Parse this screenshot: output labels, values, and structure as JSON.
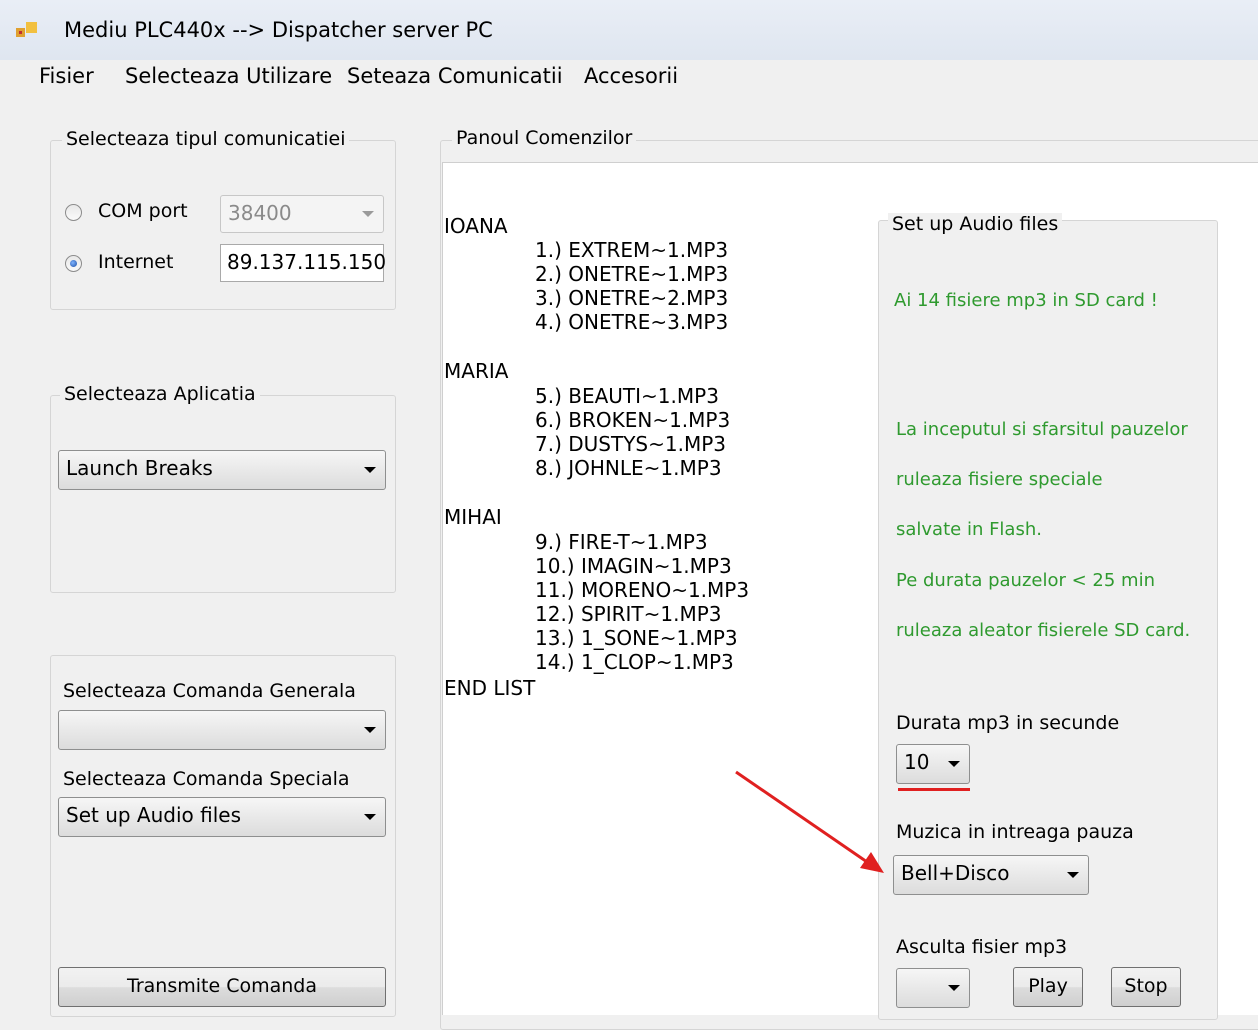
{
  "window": {
    "title": "Mediu PLC440x --> Dispatcher server PC"
  },
  "menu": [
    "Fisier",
    "Selecteaza Utilizare",
    "Seteaza Comunicatii",
    "Accesorii"
  ],
  "comm": {
    "group_label": "Selecteaza tipul comunicatiei",
    "com_label": "COM port",
    "com_value": "38400",
    "internet_label": "Internet",
    "internet_value": "89.137.115.150",
    "selected": "Internet"
  },
  "app": {
    "group_label": "Selecteaza Aplicatia",
    "value": "Launch Breaks"
  },
  "commands": {
    "general_label": "Selecteaza Comanda Generala",
    "general_value": "",
    "special_label": "Selecteaza Comanda Speciala",
    "special_value": "Set up Audio files",
    "transmit_label": "Transmite Comanda"
  },
  "panel": {
    "label": "Panoul Comenzilor",
    "users": [
      {
        "name": "IOANA",
        "files": [
          "1.)  EXTREM~1.MP3",
          "2.)  ONETRE~1.MP3",
          "3.)  ONETRE~2.MP3",
          "4.)  ONETRE~3.MP3"
        ]
      },
      {
        "name": "MARIA",
        "files": [
          "5.)  BEAUTI~1.MP3",
          "6.)  BROKEN~1.MP3",
          "7.)  DUSTYS~1.MP3",
          "8.)  JOHNLE~1.MP3"
        ]
      },
      {
        "name": "MIHAI",
        "files": [
          "9.)  FIRE-T~1.MP3",
          "10.)  IMAGIN~1.MP3",
          "11.)  MORENO~1.MP3",
          "12.)  SPIRIT~1.MP3",
          "13.)  1_SONE~1.MP3",
          "14.)  1_CLOP~1.MP3"
        ]
      }
    ],
    "end": "END LIST"
  },
  "audio": {
    "group_label": "Set up Audio files",
    "sd_count_msg": "Ai 14 fisiere mp3 in SD card !",
    "info_lines": [
      "La inceputul si sfarsitul pauzelor",
      "ruleaza fisiere speciale",
      "salvate in Flash.",
      "Pe durata pauzelor < 25 min",
      "ruleaza aleator fisierele SD card."
    ],
    "duration_label": "Durata mp3 in secunde",
    "duration_value": "10",
    "music_label": "Muzica in intreaga pauza",
    "music_value": "Bell+Disco",
    "listen_label": "Asculta fisier mp3",
    "listen_value": "",
    "play_label": "Play",
    "stop_label": "Stop"
  },
  "colors": {
    "info_text": "#2f9a2f",
    "annotation_red": "#e02020"
  }
}
